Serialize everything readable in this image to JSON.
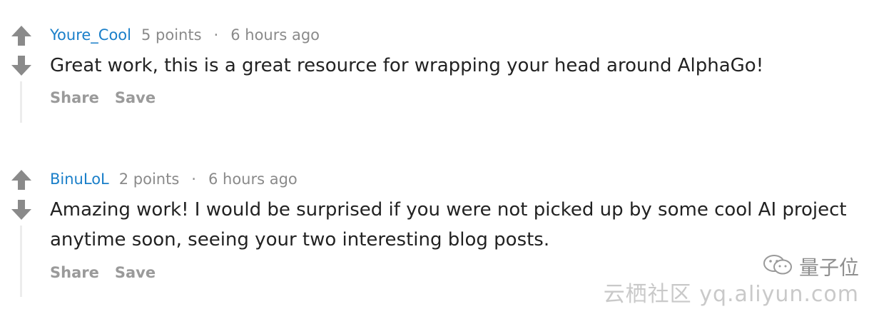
{
  "comments": [
    {
      "author": "Youre_Cool",
      "points": "5 points",
      "separator": "·",
      "time": "6 hours ago",
      "text": "Great work, this is a great resource for wrapping your head around AlphaGo!",
      "share_label": "Share",
      "save_label": "Save"
    },
    {
      "author": "BinuLoL",
      "points": "2 points",
      "separator": "·",
      "time": "6 hours ago",
      "text": "Amazing work! I would be surprised if you were not picked up by some cool AI project anytime soon, seeing your two interesting blog posts.",
      "share_label": "Share",
      "save_label": "Save"
    }
  ],
  "watermark": {
    "brand": "量子位",
    "site": "云栖社区 yq.aliyun.com"
  },
  "colors": {
    "author": "#1a7fc9",
    "meta": "#8a8a8a",
    "body": "#222222",
    "action": "#9a9a9a",
    "vote_arrow": "#8a8a8a"
  },
  "icons": {
    "upvote": "arrow-up-icon",
    "downvote": "arrow-down-icon",
    "logo": "wechat-logo-icon"
  }
}
